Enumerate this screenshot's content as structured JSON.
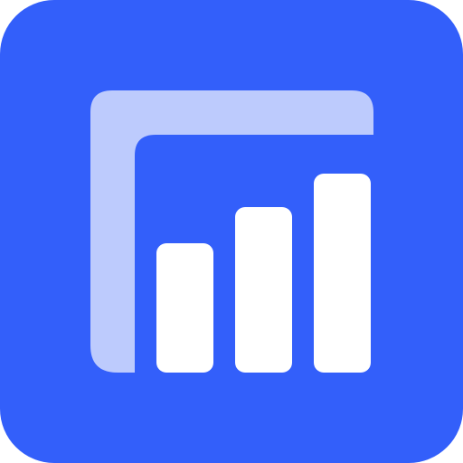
{
  "icon": {
    "name": "bar-chart-analytics-icon",
    "colors": {
      "background": "#335FFA",
      "frame": "#BDCBFD",
      "bars": "#FFFFFF"
    },
    "bars": [
      {
        "level": 0.65
      },
      {
        "level": 0.83
      },
      {
        "level": 1.0
      }
    ]
  }
}
